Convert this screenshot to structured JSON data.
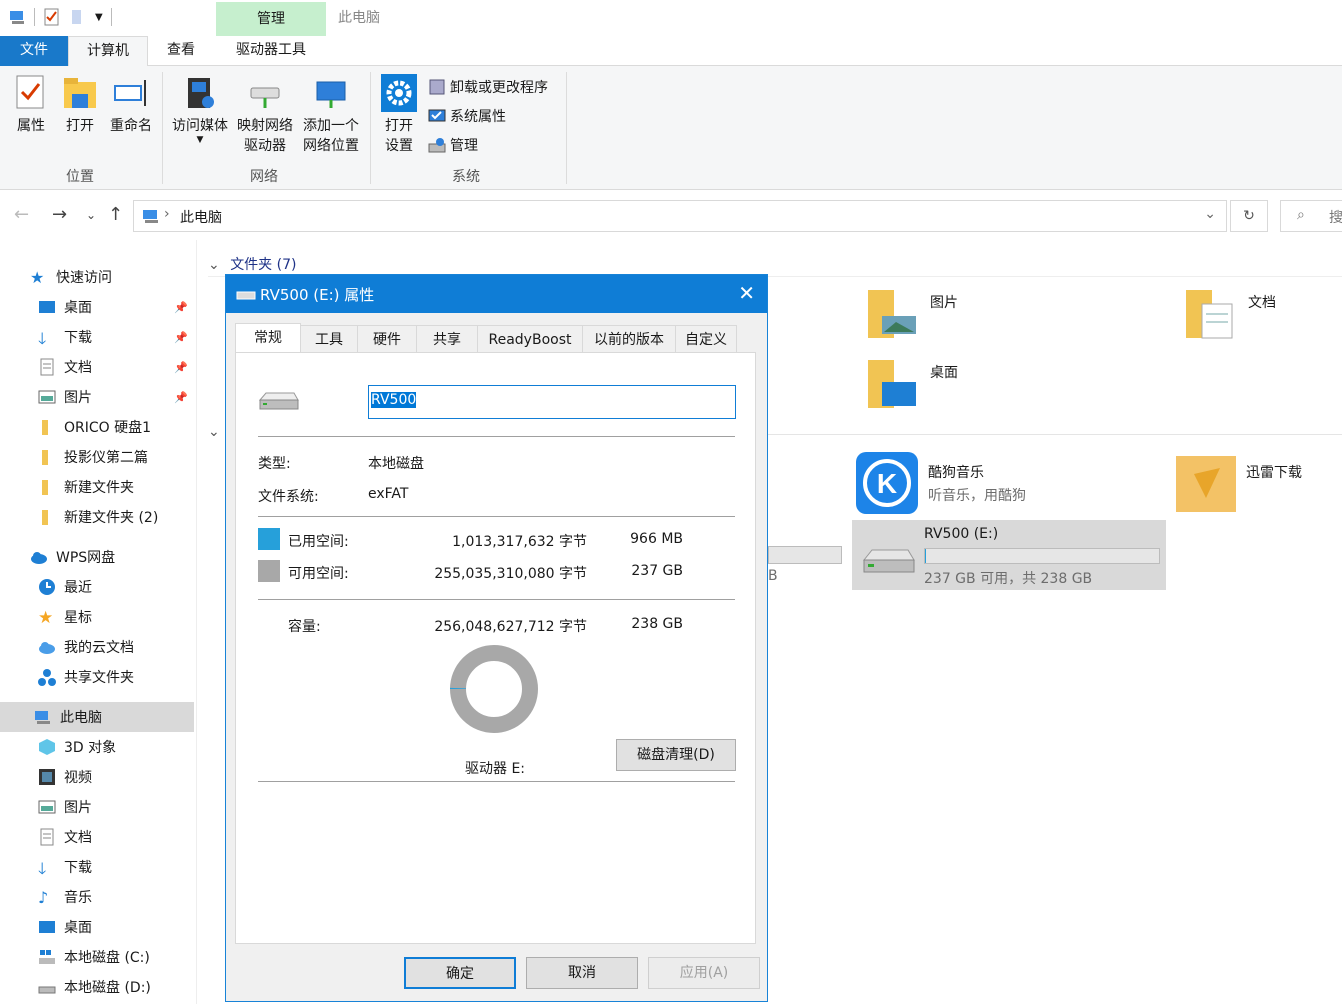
{
  "window": {
    "title": "此电脑",
    "context_tab": "管理"
  },
  "tabs": {
    "file": "文件",
    "computer": "计算机",
    "view": "查看",
    "drive_tools": "驱动器工具"
  },
  "ribbon": {
    "location": {
      "label": "位置",
      "properties": "属性",
      "open": "打开",
      "rename": "重命名"
    },
    "network": {
      "label": "网络",
      "media_l1": "访问媒体",
      "map_l1": "映射网络",
      "map_l2": "驱动器",
      "add_l1": "添加一个",
      "add_l2": "网络位置"
    },
    "system": {
      "label": "系统",
      "open_l1": "打开",
      "open_l2": "设置",
      "uninstall": "卸载或更改程序",
      "sysprops": "系统属性",
      "manage": "管理"
    }
  },
  "address": {
    "path": "此电脑",
    "search_placeholder": "搜"
  },
  "sidebar": {
    "quick_access": "快速访问",
    "quick_items": [
      "桌面",
      "下载",
      "文档",
      "图片",
      "ORICO 硬盘1",
      "投影仪第二篇",
      "新建文件夹",
      "新建文件夹 (2)"
    ],
    "wps": "WPS网盘",
    "wps_items": [
      "最近",
      "星标",
      "我的云文档",
      "共享文件夹"
    ],
    "this_pc": "此电脑",
    "pc_items": [
      "3D 对象",
      "视频",
      "图片",
      "文档",
      "下载",
      "音乐",
      "桌面",
      "本地磁盘 (C:)",
      "本地磁盘 (D:)"
    ]
  },
  "content": {
    "folders_header": "文件夹 (7)",
    "folder_pictures": "图片",
    "folder_documents": "文档",
    "folder_desktop": "桌面",
    "kugou_name": "酷狗音乐",
    "kugou_sub": "听音乐，用酷狗",
    "xunlei_name": "迅雷下载",
    "rv500_name": "RV500 (E:)",
    "rv500_free": "237 GB 可用，共 238 GB",
    "partial_tb": "B",
    "rv500_used_fraction": 0.004
  },
  "dialog": {
    "title": "RV500 (E:) 属性",
    "tabs": [
      "常规",
      "工具",
      "硬件",
      "共享",
      "ReadyBoost",
      "以前的版本",
      "自定义"
    ],
    "name_value": "RV500",
    "type_label": "类型:",
    "type_value": "本地磁盘",
    "fs_label": "文件系统:",
    "fs_value": "exFAT",
    "used_label": "已用空间:",
    "used_bytes": "1,013,317,632 字节",
    "used_size": "966 MB",
    "free_label": "可用空间:",
    "free_bytes": "255,035,310,080 字节",
    "free_size": "237 GB",
    "cap_label": "容量:",
    "cap_bytes": "256,048,627,712 字节",
    "cap_size": "238 GB",
    "drive_label": "驱动器 E:",
    "cleanup": "磁盘清理(D)",
    "ok": "确定",
    "cancel": "取消",
    "apply": "应用(A)",
    "used_color": "#26a0da",
    "free_color": "#a8a8a8"
  }
}
